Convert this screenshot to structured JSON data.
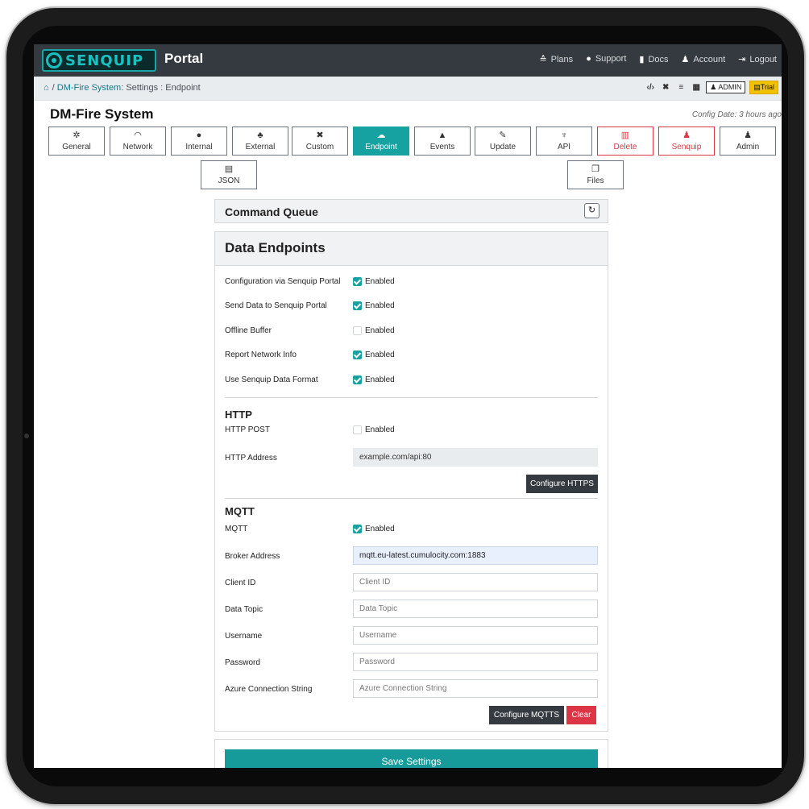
{
  "app": {
    "logo_text": "SENQUIP",
    "brand": "Portal"
  },
  "nav": {
    "plans": "Plans",
    "support": "Support",
    "docs": "Docs",
    "account": "Account",
    "logout": "Logout"
  },
  "breadcrumb": {
    "system": "DM-Fire System",
    "rest": ": Settings : Endpoint",
    "sep": "/"
  },
  "tools": {
    "admin": "ADMIN",
    "trial": "Trial"
  },
  "page": {
    "title": "DM-Fire System",
    "config_date": "Config Date: 3 hours ago"
  },
  "tabs": [
    {
      "label": "General",
      "icon": "gear-icon",
      "glyph": "✲"
    },
    {
      "label": "Network",
      "icon": "wifi-icon",
      "glyph": "◠"
    },
    {
      "label": "Internal",
      "icon": "circle-icon",
      "glyph": "●"
    },
    {
      "label": "External",
      "icon": "sitemap-icon",
      "glyph": "♣"
    },
    {
      "label": "Custom",
      "icon": "tools-icon",
      "glyph": "✖"
    },
    {
      "label": "Endpoint",
      "icon": "cloud-icon",
      "glyph": "☁"
    },
    {
      "label": "Events",
      "icon": "bell-icon",
      "glyph": "▲"
    },
    {
      "label": "Update",
      "icon": "wrench-icon",
      "glyph": "✎"
    },
    {
      "label": "API",
      "icon": "plug-icon",
      "glyph": "♆"
    },
    {
      "label": "Delete",
      "icon": "trash-icon",
      "glyph": "▥"
    },
    {
      "label": "Senquip",
      "icon": "user-cog-icon",
      "glyph": "♟"
    },
    {
      "label": "Admin",
      "icon": "user-cog-icon",
      "glyph": "♟"
    },
    {
      "label": "JSON",
      "icon": "file-icon",
      "glyph": "▤"
    },
    {
      "label": "Files",
      "icon": "copy-icon",
      "glyph": "❐"
    }
  ],
  "command_queue": {
    "title": "Command Queue"
  },
  "endpoints": {
    "title": "Data Endpoints",
    "enabled_label": "Enabled",
    "rows": [
      {
        "label": "Configuration via Senquip Portal",
        "checked": true
      },
      {
        "label": "Send Data to Senquip Portal",
        "checked": true
      },
      {
        "label": "Offline Buffer",
        "checked": false
      },
      {
        "label": "Report Network Info",
        "checked": true
      },
      {
        "label": "Use Senquip Data Format",
        "checked": true
      }
    ]
  },
  "http": {
    "section": "HTTP",
    "post_label": "HTTP POST",
    "post_checked": false,
    "address_label": "HTTP Address",
    "address_value": "example.com/api:80",
    "configure": "Configure HTTPS"
  },
  "mqtt": {
    "section": "MQTT",
    "mqtt_label": "MQTT",
    "mqtt_checked": true,
    "broker_label": "Broker Address",
    "broker_value": "mqtt.eu-latest.cumulocity.com:1883",
    "client_label": "Client ID",
    "client_placeholder": "Client ID",
    "topic_label": "Data Topic",
    "topic_placeholder": "Data Topic",
    "user_label": "Username",
    "user_placeholder": "Username",
    "pass_label": "Password",
    "pass_placeholder": "Password",
    "azure_label": "Azure Connection String",
    "azure_placeholder": "Azure Connection String",
    "configure": "Configure MQTTS",
    "clear": "Clear"
  },
  "save": "Save Settings",
  "colors": {
    "accent": "#17a2a2",
    "navbar": "#343a40",
    "danger": "#dc3545",
    "trial": "#f2c200"
  }
}
